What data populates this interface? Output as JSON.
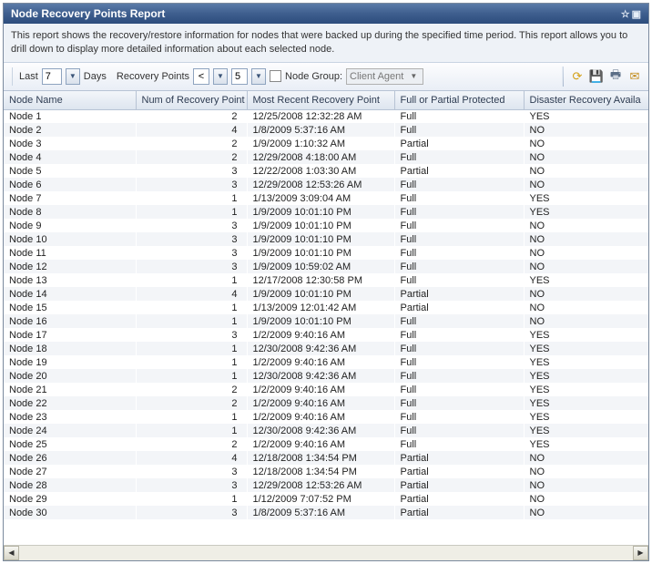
{
  "title": "Node Recovery Points Report",
  "description": "This report shows the recovery/restore information for nodes that were backed up during the specified time period. This report allows you to drill down to display more detailed information about each selected node.",
  "toolbar": {
    "last_label": "Last",
    "last_value": "7",
    "days_label": "Days",
    "recovery_points_label": "Recovery Points",
    "op_value": "<",
    "op_count": "5",
    "node_group_label": "Node Group:",
    "node_group_value": "Client Agent"
  },
  "columns": {
    "c0": "Node Name",
    "c1": "Num of Recovery Point",
    "c2": "Most Recent Recovery Point",
    "c3": "Full or Partial Protected",
    "c4": "Disaster Recovery Availa"
  },
  "rows": [
    {
      "name": "Node 1",
      "num": "2",
      "recent": "12/25/2008 12:32:28 AM",
      "prot": "Full",
      "dr": "YES"
    },
    {
      "name": "Node 2",
      "num": "4",
      "recent": "1/8/2009 5:37:16 AM",
      "prot": "Full",
      "dr": "NO"
    },
    {
      "name": "Node 3",
      "num": "2",
      "recent": "1/9/2009 1:10:32 AM",
      "prot": "Partial",
      "dr": "NO"
    },
    {
      "name": "Node 4",
      "num": "2",
      "recent": "12/29/2008 4:18:00 AM",
      "prot": "Full",
      "dr": "NO"
    },
    {
      "name": "Node 5",
      "num": "3",
      "recent": "12/22/2008 1:03:30 AM",
      "prot": "Partial",
      "dr": "NO"
    },
    {
      "name": "Node 6",
      "num": "3",
      "recent": "12/29/2008 12:53:26 AM",
      "prot": "Full",
      "dr": "NO"
    },
    {
      "name": "Node 7",
      "num": "1",
      "recent": "1/13/2009 3:09:04 AM",
      "prot": "Full",
      "dr": "YES"
    },
    {
      "name": "Node 8",
      "num": "1",
      "recent": "1/9/2009 10:01:10 PM",
      "prot": "Full",
      "dr": "YES"
    },
    {
      "name": "Node 9",
      "num": "3",
      "recent": "1/9/2009 10:01:10 PM",
      "prot": "Full",
      "dr": "NO"
    },
    {
      "name": "Node 10",
      "num": "3",
      "recent": "1/9/2009 10:01:10 PM",
      "prot": "Full",
      "dr": "NO"
    },
    {
      "name": "Node 11",
      "num": "3",
      "recent": "1/9/2009 10:01:10 PM",
      "prot": "Full",
      "dr": "NO"
    },
    {
      "name": "Node 12",
      "num": "3",
      "recent": "1/9/2009 10:59:02 AM",
      "prot": "Full",
      "dr": "NO"
    },
    {
      "name": "Node 13",
      "num": "1",
      "recent": "12/17/2008 12:30:58 PM",
      "prot": "Full",
      "dr": "YES"
    },
    {
      "name": "Node 14",
      "num": "4",
      "recent": "1/9/2009 10:01:10 PM",
      "prot": "Partial",
      "dr": "NO"
    },
    {
      "name": "Node 15",
      "num": "1",
      "recent": "1/13/2009 12:01:42 AM",
      "prot": "Partial",
      "dr": "NO"
    },
    {
      "name": "Node 16",
      "num": "1",
      "recent": "1/9/2009 10:01:10 PM",
      "prot": "Full",
      "dr": "NO"
    },
    {
      "name": "Node 17",
      "num": "3",
      "recent": "1/2/2009 9:40:16 AM",
      "prot": "Full",
      "dr": "YES"
    },
    {
      "name": "Node 18",
      "num": "1",
      "recent": "12/30/2008 9:42:36 AM",
      "prot": "Full",
      "dr": "YES"
    },
    {
      "name": "Node 19",
      "num": "1",
      "recent": "1/2/2009 9:40:16 AM",
      "prot": "Full",
      "dr": "YES"
    },
    {
      "name": "Node 20",
      "num": "1",
      "recent": "12/30/2008 9:42:36 AM",
      "prot": "Full",
      "dr": "YES"
    },
    {
      "name": "Node 21",
      "num": "2",
      "recent": "1/2/2009 9:40:16 AM",
      "prot": "Full",
      "dr": "YES"
    },
    {
      "name": "Node 22",
      "num": "2",
      "recent": "1/2/2009 9:40:16 AM",
      "prot": "Full",
      "dr": "YES"
    },
    {
      "name": "Node 23",
      "num": "1",
      "recent": "1/2/2009 9:40:16 AM",
      "prot": "Full",
      "dr": "YES"
    },
    {
      "name": "Node 24",
      "num": "1",
      "recent": "12/30/2008 9:42:36 AM",
      "prot": "Full",
      "dr": "YES"
    },
    {
      "name": "Node 25",
      "num": "2",
      "recent": "1/2/2009 9:40:16 AM",
      "prot": "Full",
      "dr": "YES"
    },
    {
      "name": "Node 26",
      "num": "4",
      "recent": "12/18/2008 1:34:54 PM",
      "prot": "Partial",
      "dr": "NO"
    },
    {
      "name": "Node 27",
      "num": "3",
      "recent": "12/18/2008 1:34:54 PM",
      "prot": "Partial",
      "dr": "NO"
    },
    {
      "name": "Node 28",
      "num": "3",
      "recent": "12/29/2008 12:53:26 AM",
      "prot": "Partial",
      "dr": "NO"
    },
    {
      "name": "Node 29",
      "num": "1",
      "recent": "1/12/2009 7:07:52 PM",
      "prot": "Partial",
      "dr": "NO"
    },
    {
      "name": "Node 30",
      "num": "3",
      "recent": "1/8/2009 5:37:16 AM",
      "prot": "Partial",
      "dr": "NO"
    }
  ]
}
